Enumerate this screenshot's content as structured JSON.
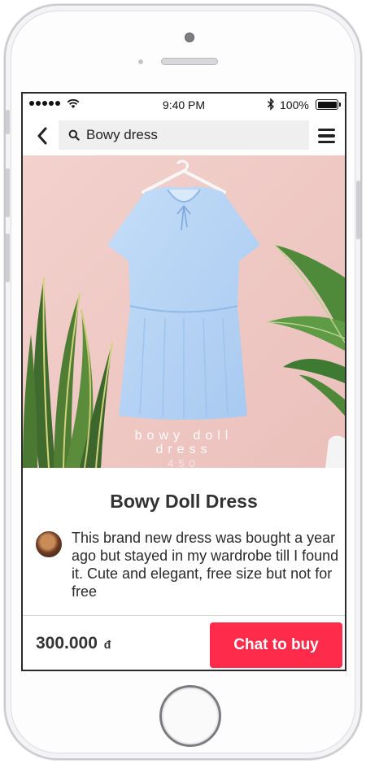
{
  "status_bar": {
    "time": "9:40 PM",
    "battery_percent": "100%",
    "signal_icon": "signal-dots-icon",
    "wifi_icon": "wifi-icon",
    "bluetooth_icon": "bluetooth-icon",
    "battery_icon": "battery-full-icon"
  },
  "nav": {
    "back_icon": "chevron-left-icon",
    "search_icon": "search-icon",
    "search_value": "Bowy dress",
    "menu_icon": "hamburger-menu-icon"
  },
  "product": {
    "image_caption_line1": "bowy doll",
    "image_caption_line2": "dress",
    "image_caption_line3": "450",
    "title": "Bowy Doll Dress",
    "description": "This brand new dress was bought a year ago but stayed in my wardrobe till I found it. Cute and elegant, free size but not for free",
    "price": "300.000",
    "currency": "đ"
  },
  "actions": {
    "chat_label": "Chat to buy"
  },
  "colors": {
    "accent": "#ff2b4a",
    "image_background": "#f1ccc8",
    "dress": "#b9d8f7"
  }
}
